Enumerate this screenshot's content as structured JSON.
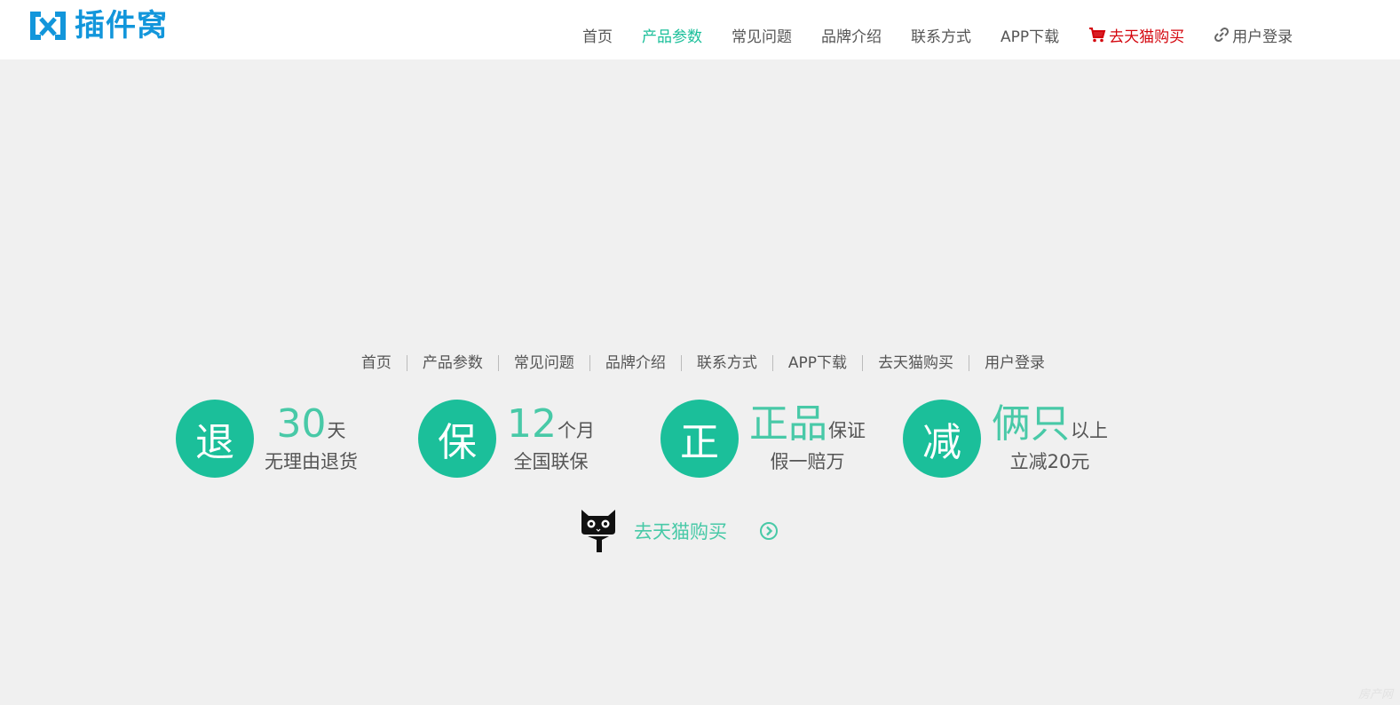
{
  "header": {
    "logo_text": "插件窝",
    "nav": [
      {
        "label": "首页"
      },
      {
        "label": "产品参数"
      },
      {
        "label": "常见问题"
      },
      {
        "label": "品牌介绍"
      },
      {
        "label": "联系方式"
      },
      {
        "label": "APP下载"
      },
      {
        "label": "去天猫购买",
        "icon": "cart-icon"
      },
      {
        "label": "用户登录",
        "icon": "link-icon"
      }
    ],
    "active_index": 1
  },
  "footer_links": [
    "首页",
    "产品参数",
    "常见问题",
    "品牌介绍",
    "联系方式",
    "APP下载",
    "去天猫购买",
    "用户登录"
  ],
  "features": [
    {
      "circle": "退",
      "big": "30",
      "small": "天",
      "bottom": "无理由退货"
    },
    {
      "circle": "保",
      "big": "12",
      "small": "个月",
      "bottom": "全国联保"
    },
    {
      "circle": "正",
      "big": "正品",
      "small": "保证",
      "bottom": "假一赔万"
    },
    {
      "circle": "减",
      "big": "俩只",
      "small": "以上",
      "bottom": "立减20元"
    }
  ],
  "buy": {
    "label": "去天猫购买",
    "icon": "tmall-cat-icon",
    "arrow_icon": "circle-chevron-right-icon"
  },
  "watermark": "房产网",
  "colors": {
    "accent": "#1bbf9a",
    "logo": "#1296db",
    "tmall": "#d4050d",
    "background": "#f0f0f0"
  }
}
